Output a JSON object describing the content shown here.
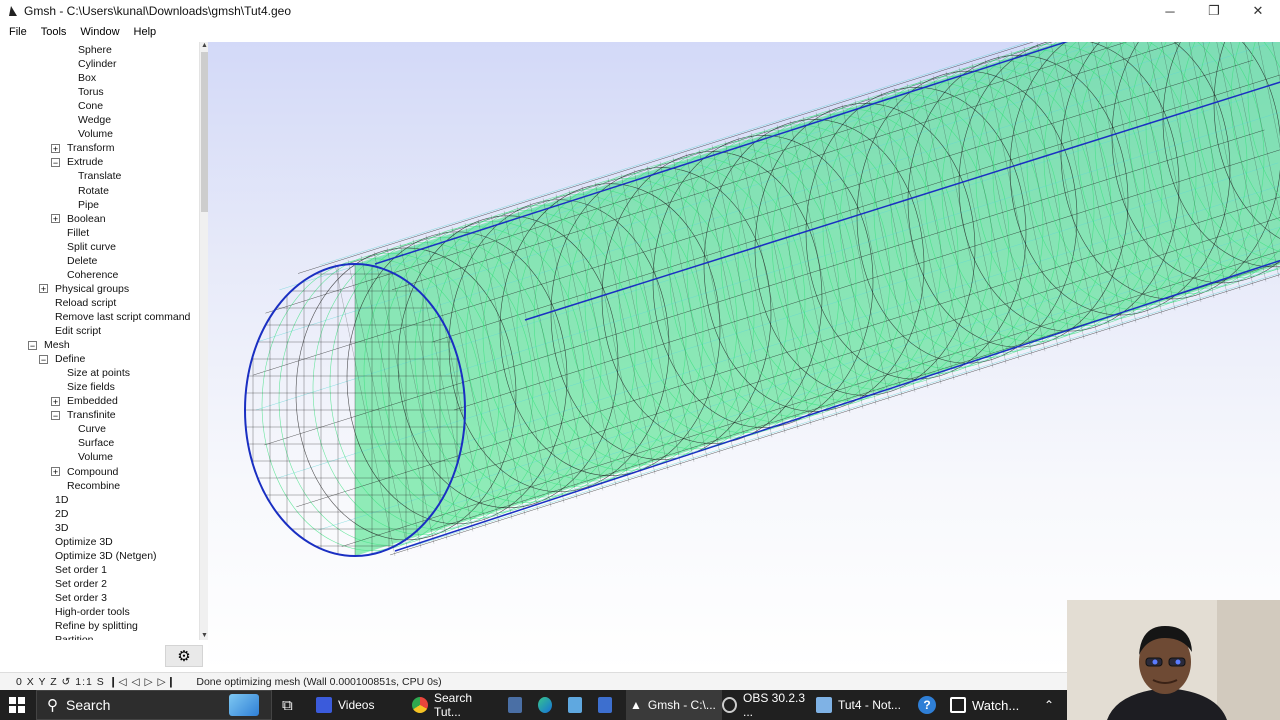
{
  "window": {
    "title": "Gmsh - C:\\Users\\kunal\\Downloads\\gmsh\\Tut4.geo",
    "minimize_glyph": "─",
    "restore_glyph": "❐",
    "close_glyph": "✕"
  },
  "menubar": {
    "items": [
      {
        "label": "File"
      },
      {
        "label": "Tools"
      },
      {
        "label": "Window"
      },
      {
        "label": "Help"
      }
    ]
  },
  "tree": {
    "items": [
      {
        "label": "Sphere",
        "level": 3,
        "toggle": ""
      },
      {
        "label": "Cylinder",
        "level": 3,
        "toggle": ""
      },
      {
        "label": "Box",
        "level": 3,
        "toggle": ""
      },
      {
        "label": "Torus",
        "level": 3,
        "toggle": ""
      },
      {
        "label": "Cone",
        "level": 3,
        "toggle": ""
      },
      {
        "label": "Wedge",
        "level": 3,
        "toggle": ""
      },
      {
        "label": "Volume",
        "level": 3,
        "toggle": ""
      },
      {
        "label": "Transform",
        "level": 2,
        "toggle": "+"
      },
      {
        "label": "Extrude",
        "level": 2,
        "toggle": "−"
      },
      {
        "label": "Translate",
        "level": 3,
        "toggle": ""
      },
      {
        "label": "Rotate",
        "level": 3,
        "toggle": ""
      },
      {
        "label": "Pipe",
        "level": 3,
        "toggle": ""
      },
      {
        "label": "Boolean",
        "level": 2,
        "toggle": "+"
      },
      {
        "label": "Fillet",
        "level": 2,
        "toggle": ""
      },
      {
        "label": "Split curve",
        "level": 2,
        "toggle": ""
      },
      {
        "label": "Delete",
        "level": 2,
        "toggle": ""
      },
      {
        "label": "Coherence",
        "level": 2,
        "toggle": ""
      },
      {
        "label": "Physical groups",
        "level": 1,
        "toggle": "+"
      },
      {
        "label": "Reload script",
        "level": 1,
        "toggle": ""
      },
      {
        "label": "Remove last script command",
        "level": 1,
        "toggle": ""
      },
      {
        "label": "Edit script",
        "level": 1,
        "toggle": ""
      },
      {
        "label": "Mesh",
        "level": 0,
        "toggle": "−"
      },
      {
        "label": "Define",
        "level": 1,
        "toggle": "−"
      },
      {
        "label": "Size at points",
        "level": 2,
        "toggle": ""
      },
      {
        "label": "Size fields",
        "level": 2,
        "toggle": ""
      },
      {
        "label": "Embedded",
        "level": 2,
        "toggle": "+"
      },
      {
        "label": "Transfinite",
        "level": 2,
        "toggle": "−"
      },
      {
        "label": "Curve",
        "level": 3,
        "toggle": ""
      },
      {
        "label": "Surface",
        "level": 3,
        "toggle": ""
      },
      {
        "label": "Volume",
        "level": 3,
        "toggle": ""
      },
      {
        "label": "Compound",
        "level": 2,
        "toggle": "+"
      },
      {
        "label": "Recombine",
        "level": 2,
        "toggle": ""
      },
      {
        "label": "1D",
        "level": 1,
        "toggle": ""
      },
      {
        "label": "2D",
        "level": 1,
        "toggle": ""
      },
      {
        "label": "3D",
        "level": 1,
        "toggle": ""
      },
      {
        "label": "Optimize 3D",
        "level": 1,
        "toggle": ""
      },
      {
        "label": "Optimize 3D (Netgen)",
        "level": 1,
        "toggle": ""
      },
      {
        "label": "Set order 1",
        "level": 1,
        "toggle": ""
      },
      {
        "label": "Set order 2",
        "level": 1,
        "toggle": ""
      },
      {
        "label": "Set order 3",
        "level": 1,
        "toggle": ""
      },
      {
        "label": "High-order tools",
        "level": 1,
        "toggle": ""
      },
      {
        "label": "Refine by splitting",
        "level": 1,
        "toggle": ""
      },
      {
        "label": "Partition",
        "level": 1,
        "toggle": ""
      }
    ]
  },
  "statusbar": {
    "controls": "0 X Y Z ↺ 1:1 S ❙◁ ◁ ▷ ▷❙",
    "message": "Done optimizing mesh (Wall 0.000100851s, CPU 0s)"
  },
  "taskbar": {
    "search_label": "Search",
    "apps": [
      {
        "label": "Videos",
        "color": "#3b5bdb"
      },
      {
        "label": "Search Tut...",
        "color": "#e8453c"
      },
      {
        "label": "Gmsh - C:\\...",
        "color": "#ffffff"
      },
      {
        "label": "OBS 30.2.3 ...",
        "color": "#cccccc"
      },
      {
        "label": "Tut4 - Not...",
        "color": "#7fb2e5"
      },
      {
        "label": "Watch...",
        "color": "#ffffff"
      }
    ]
  },
  "colors": {
    "mesh_green": "#39e07e",
    "mesh_cyan": "#5fd6d6",
    "mesh_black": "#1a1a1a",
    "curve_blue": "#1a2fc2"
  }
}
